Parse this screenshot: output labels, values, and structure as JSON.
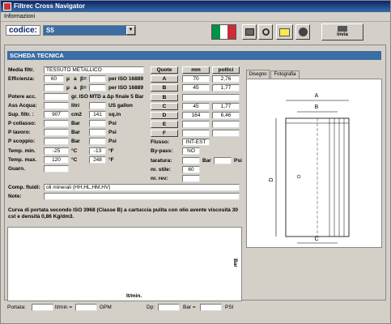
{
  "window": {
    "title": "Filtrec Cross Navigator"
  },
  "menu": {
    "items": [
      "Informazioni"
    ]
  },
  "toolbar": {
    "codice_label": "codice:",
    "codice_value": "S5",
    "invia_label": "invia",
    "flag_colors": [
      "#009246",
      "#ffffff",
      "#ce2b37"
    ]
  },
  "scheda": {
    "title": "SCHEDA TECNICA"
  },
  "labels": {
    "media": "Media filtr.",
    "efficienza": "Efficienza:",
    "potere": "Potere acc.",
    "ass_acqua": "Ass Acqua:",
    "sup_filtr": "Sup. filtr. :",
    "p_collasso": "P collasso:",
    "p_lavoro": "P lavoro:",
    "p_scoppio": "P scoppio:",
    "temp_min": "Temp. min.",
    "temp_max": "Temp. max.",
    "guarn": "Guarn.",
    "fluidi": "Comp. fluidi:",
    "note": "Note:",
    "mu": "μ",
    "a": "a",
    "beta": "β=",
    "iso16889": "per ISO 16889",
    "gr_iso": "gr. ISO MTD a Δp finale 5 Bar",
    "litri": "litri",
    "us_gallon": "US gallon",
    "cm2": "cm2",
    "sqin": "sq.in",
    "bar": "Bar",
    "psi": "Psi",
    "degc": "°C",
    "degf": "°F"
  },
  "values": {
    "media": "TESSUTO METALLICO",
    "eff1_mu": "60",
    "sup_cm2": "907",
    "sup_sqin": "141",
    "temp_min_c": "-25",
    "temp_min_f": "-13",
    "temp_max_c": "120",
    "temp_max_f": "248",
    "fluidi": "oli minerali (HH,HL,HM,HV)"
  },
  "quote": {
    "headers": [
      "Quote",
      "mm",
      "pollici"
    ],
    "rows": [
      {
        "label": "A",
        "mm": "70",
        "in": "2,76"
      },
      {
        "label": "B",
        "mm": "45",
        "in": "1,77"
      },
      {
        "label": "B",
        "mm": "",
        "in": ""
      },
      {
        "label": "C",
        "mm": "45",
        "in": "1,77"
      },
      {
        "label": "D",
        "mm": "164",
        "in": "6,46"
      },
      {
        "label": "E",
        "mm": "",
        "in": ""
      },
      {
        "label": "F",
        "mm": "",
        "in": ""
      }
    ]
  },
  "extra": {
    "flusso_label": "Flusso:",
    "flusso_value": "INT-EST",
    "bypass_label": "By-pass:",
    "bypass_value": "NO",
    "taratura_label": "taratura:",
    "taratura_bar": "Bar",
    "taratura_psi": "Psi",
    "stile_label": "nr. stile:",
    "stile_value": "60",
    "rev_label": "nr. rev:"
  },
  "tabs": {
    "disegno": "Disegno",
    "fotografia": "Fotografia"
  },
  "drawing": {
    "A": "A",
    "B": "B",
    "C": "C",
    "D": "D"
  },
  "curve": {
    "description": "Curva di portata secondo ISO 3968 (Classe B) a cartuccia pulita con olio avente viscosità 30 cst e densità 0,86 Kg/dm3.",
    "xlabel": "lt/min.",
    "ylabel": "Bar"
  },
  "footer": {
    "portata": "Portata:",
    "ltmin": "lt/min =",
    "gpm": "GPM",
    "dp": "Dp:",
    "bar": "Bar =",
    "psi": "PSI"
  }
}
